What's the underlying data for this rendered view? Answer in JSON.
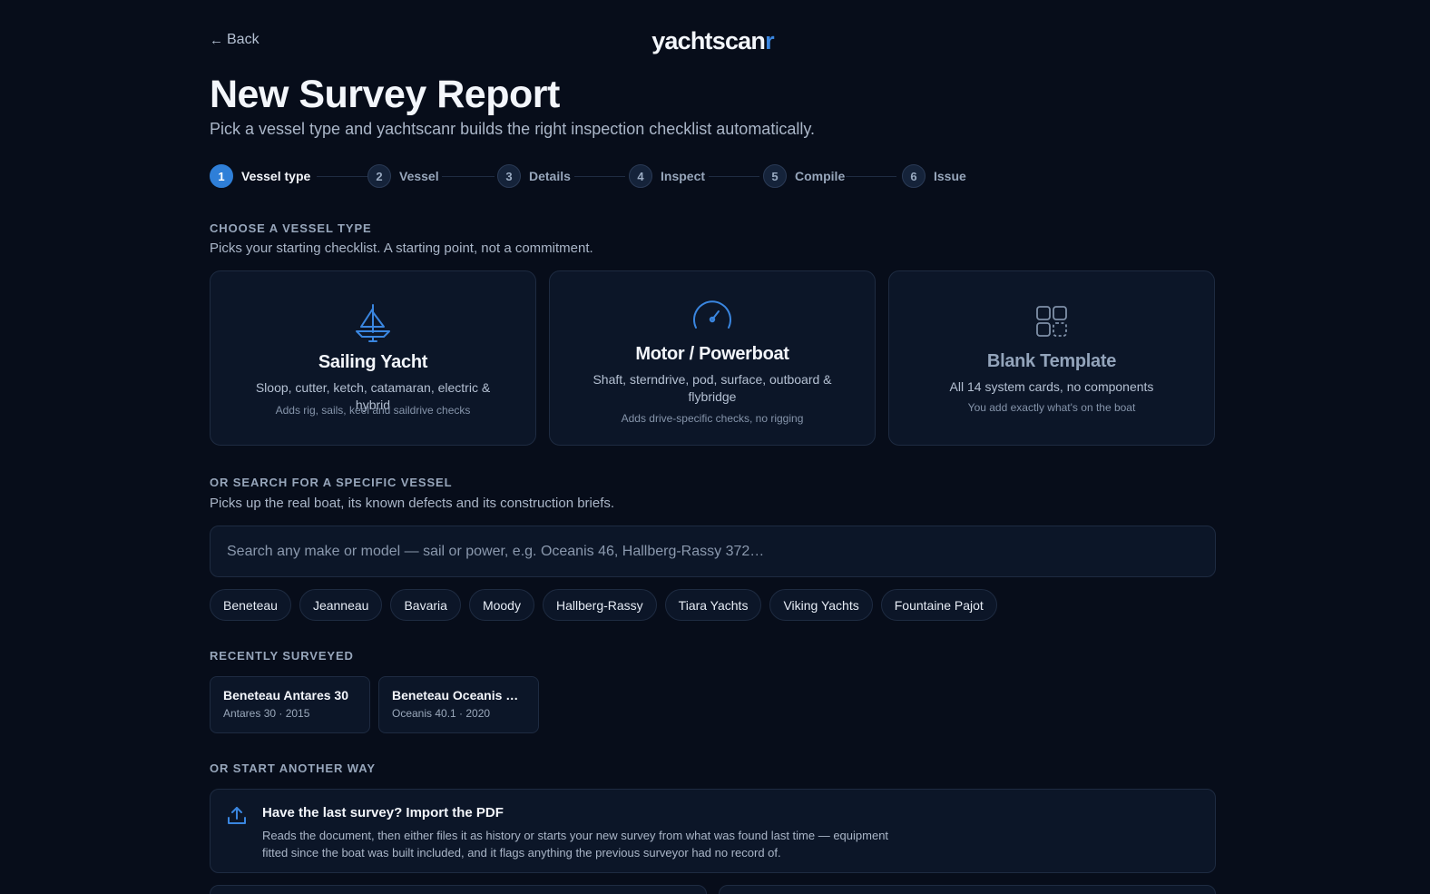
{
  "header": {
    "back_label": "Back",
    "logo_main": "yachtscan",
    "logo_accent": "r"
  },
  "page": {
    "title": "New Survey Report",
    "subtitle": "Pick a vessel type and yachtscanr builds the right inspection checklist automatically."
  },
  "steps": [
    {
      "num": "1",
      "label": "Vessel type",
      "active": true
    },
    {
      "num": "2",
      "label": "Vessel",
      "active": false
    },
    {
      "num": "3",
      "label": "Details",
      "active": false
    },
    {
      "num": "4",
      "label": "Inspect",
      "active": false
    },
    {
      "num": "5",
      "label": "Compile",
      "active": false
    },
    {
      "num": "6",
      "label": "Issue",
      "active": false
    }
  ],
  "vessel_type": {
    "label": "Choose a vessel type",
    "desc": "Picks your starting checklist. A starting point, not a commitment.",
    "cards": [
      {
        "icon": "sailboat-icon",
        "title": "Sailing Yacht",
        "desc": "Sloop, cutter, ketch, catamaran, electric & hybrid",
        "note": "Adds rig, sails, keel and saildrive checks"
      },
      {
        "icon": "gauge-icon",
        "title": "Motor / Powerboat",
        "desc": "Shaft, sterndrive, pod, surface, outboard & flybridge",
        "note": "Adds drive-specific checks, no rigging"
      },
      {
        "icon": "grid-icon",
        "title": "Blank Template",
        "desc": "All 14 system cards, no components",
        "note": "You add exactly what's on the boat"
      }
    ]
  },
  "search": {
    "label": "Or search for a specific vessel",
    "desc": "Picks up the real boat, its known defects and its construction briefs.",
    "placeholder": "Search any make or model — sail or power, e.g. Oceanis 46, Hallberg-Rassy 372…",
    "value": "",
    "chips": [
      "Beneteau",
      "Jeanneau",
      "Bavaria",
      "Moody",
      "Hallberg-Rassy",
      "Tiara Yachts",
      "Viking Yachts",
      "Fountaine Pajot"
    ]
  },
  "recent": {
    "label": "Recently surveyed",
    "items": [
      {
        "title": "Beneteau Antares 30",
        "sub": "Antares 30 · 2015"
      },
      {
        "title": "Beneteau Oceanis 4…",
        "sub": "Oceanis 40.1 · 2020"
      }
    ]
  },
  "other": {
    "label": "Or start another way",
    "import_title": "Have the last survey? Import the PDF",
    "import_desc": "Reads the document, then either files it as history or starts your new survey from what was found last time — equipment fitted since the boat was built included, and it flags anything the previous surveyor had no record of."
  },
  "colors": {
    "background": "#070d1a",
    "card": "#0c1628",
    "accent": "#2f7fd8",
    "text": "#f3f6fb",
    "muted": "#aab6c8"
  }
}
